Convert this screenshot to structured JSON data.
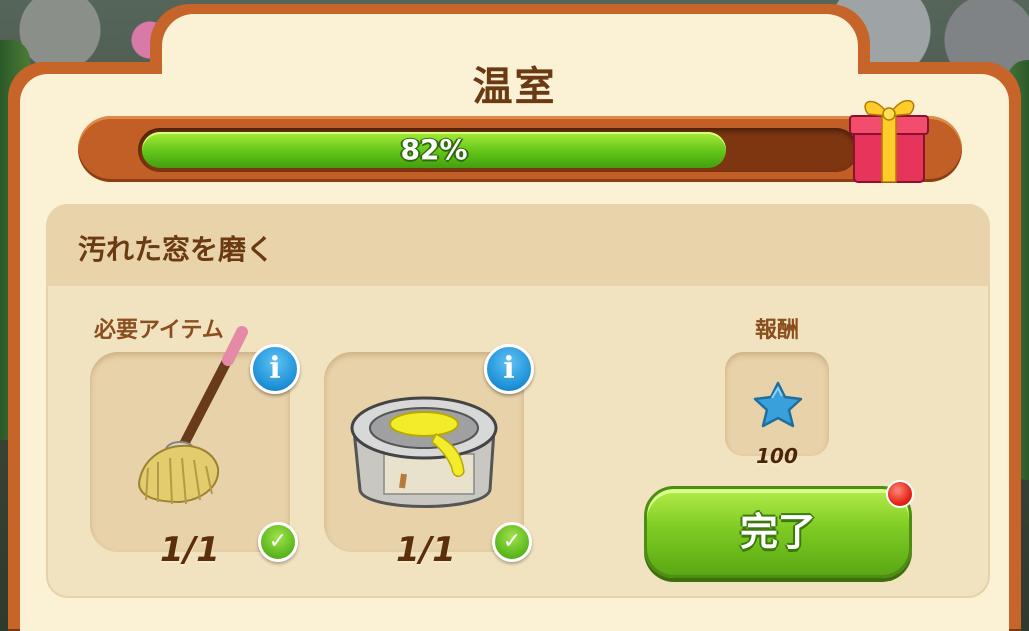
{
  "scene": {
    "title": "温室"
  },
  "progress": {
    "value": 0.82,
    "label": "82%"
  },
  "task": {
    "title": "汚れた窓を磨く",
    "required_label": "必要アイテム",
    "items": [
      {
        "name": "mop",
        "count": "1/1",
        "complete": true
      },
      {
        "name": "paint-can",
        "count": "1/1",
        "complete": true
      }
    ]
  },
  "reward": {
    "label": "報酬",
    "amount": "100",
    "icon": "blue-star-icon"
  },
  "actions": {
    "complete_label": "完了"
  },
  "colors": {
    "frame": "#c6642a",
    "panel": "#fbf2d6",
    "title": "#6b3a12",
    "progress_fill": "#62c419",
    "button": "#7fcb24"
  }
}
